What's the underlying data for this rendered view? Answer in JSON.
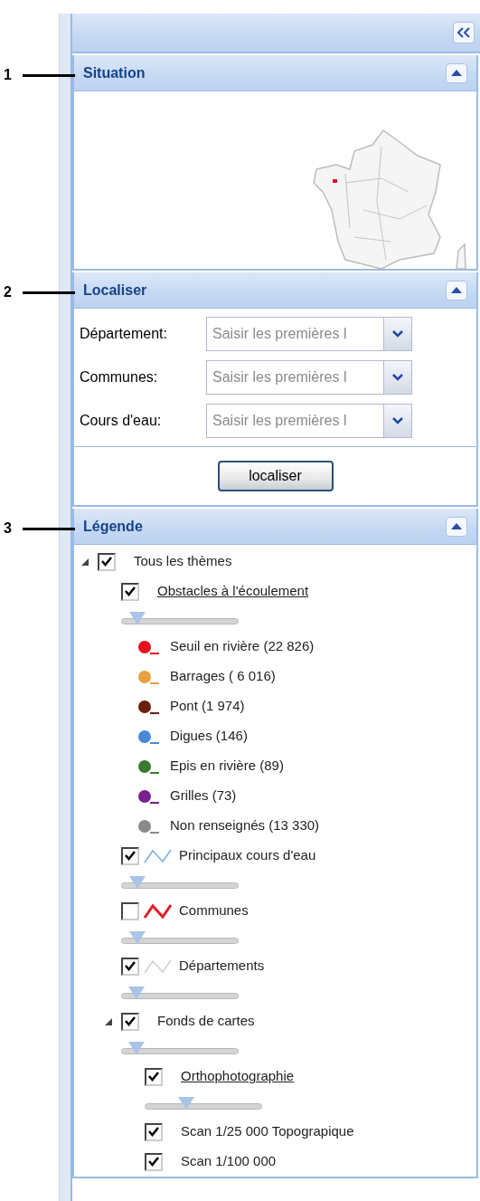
{
  "sections": [
    {
      "kind": "map",
      "title": "Situation",
      "callout": "1",
      "expanded": true
    },
    {
      "kind": "search",
      "title": "Localiser",
      "callout": "2",
      "expanded": true,
      "fields": [
        {
          "label": "Département:",
          "placeholder": "Saisir les premières l"
        },
        {
          "label": "Communes:",
          "placeholder": "Saisir les premières l"
        },
        {
          "label": "Cours d'eau:",
          "placeholder": "Saisir les premières l"
        }
      ],
      "button": "localiser"
    },
    {
      "kind": "legend",
      "title": "Légende",
      "callout": "3",
      "expanded": true,
      "tree": [
        {
          "kind": "group",
          "label": "Tous les thèmes",
          "checked": true,
          "expanded": true,
          "children": [
            {
              "kind": "layer",
              "label": "Obstacles à l'écoulement",
              "link": true,
              "checked": true,
              "level": 0.08,
              "children": [
                {
                  "kind": "class",
                  "label": "Seuil en rivière (22 826)",
                  "color": "#e8101c"
                },
                {
                  "kind": "class",
                  "label": "Barrages ( 6 016)",
                  "color": "#e8a040"
                },
                {
                  "kind": "class",
                  "label": "Pont (1 974)",
                  "color": "#6a2008"
                },
                {
                  "kind": "class",
                  "label": "Digues (146)",
                  "color": "#4a88d8"
                },
                {
                  "kind": "class",
                  "label": "Epis en rivière (89)",
                  "color": "#3a7a30"
                },
                {
                  "kind": "class",
                  "label": "Grilles (73)",
                  "color": "#7a2090"
                },
                {
                  "kind": "class",
                  "label": "Non renseignés (13 330)",
                  "color": "#8a8a8a"
                }
              ]
            },
            {
              "kind": "layer",
              "label": "Principaux cours d'eau",
              "checked": true,
              "color": "#7ab0d8",
              "level": 0.08
            },
            {
              "kind": "layer",
              "label": "Communes",
              "checked": false,
              "color": "#e0202a",
              "level": 0.08
            },
            {
              "kind": "layer",
              "label": "Départements",
              "checked": true,
              "color": "#d0d0d0",
              "level": 0.07
            },
            {
              "kind": "group",
              "label": "Fonds de cartes",
              "checked": true,
              "expanded": true,
              "level": 0.07,
              "children": [
                {
                  "kind": "layer",
                  "label": "Orthophotographie",
                  "link": true,
                  "checked": true,
                  "level": 0.32
                },
                {
                  "kind": "layer",
                  "label": "Scan 1/25 000 Topograpique",
                  "checked": true
                },
                {
                  "kind": "layer",
                  "label": "Scan 1/100 000",
                  "checked": true
                }
              ]
            }
          ]
        }
      ]
    }
  ]
}
